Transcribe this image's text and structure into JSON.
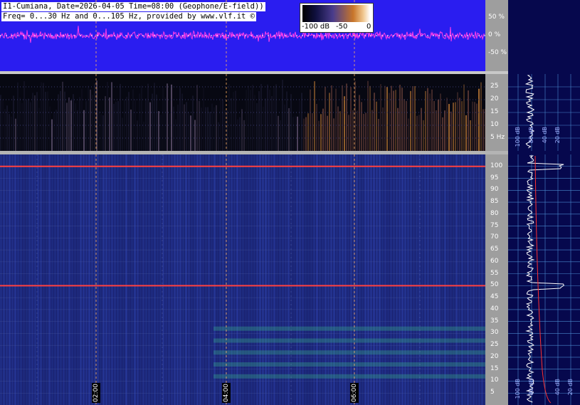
{
  "header": {
    "line1": "I1-Cumiana, Date=2026-04-05 Time=08:00 (Geophone/E-field))",
    "line2": "Freq= 0...30 Hz and 0...105 Hz, provided by www.vlf.it ©"
  },
  "scale": {
    "min_label": "-100 dB",
    "mid_label": "-50",
    "max_label": "0"
  },
  "colors": {
    "waveform_bg": "#2a1df0",
    "waveform_trace": "#ff3ce8",
    "spectrogram_low_bg": "#070812",
    "spectrogram_high_bg": "#1a2270",
    "profile_bg": "#06084d",
    "mains_line": "#ff4040",
    "grid": "#ffb060",
    "profile_curve": "#ffffff",
    "profile_mean": "#ff3030"
  },
  "chart_data": [
    {
      "type": "line",
      "panel": "waveform",
      "ylabel": "",
      "ylim": [
        -100,
        100
      ],
      "yticks": [
        50,
        0,
        -50
      ],
      "ytick_labels": [
        "50 %",
        "0 %",
        "-50 %"
      ]
    },
    {
      "type": "heatmap",
      "panel": "spectrogram-low",
      "yticks": [
        25,
        20,
        15,
        10,
        5
      ],
      "ytick_labels": [
        "25",
        "20",
        "15",
        "10",
        "5 Hz"
      ],
      "ylim": [
        0,
        30
      ]
    },
    {
      "type": "heatmap",
      "panel": "spectrogram-high",
      "yticks": [
        100,
        95,
        90,
        85,
        80,
        75,
        70,
        65,
        60,
        55,
        50,
        45,
        40,
        35,
        30,
        25,
        20,
        15,
        10,
        5
      ],
      "ytick_labels": [
        "100",
        "95",
        "90",
        "85",
        "80",
        "75",
        "70",
        "65",
        "60",
        "55",
        "50",
        "45",
        "40",
        "35",
        "30",
        "25",
        "20",
        "15",
        "10",
        "5"
      ],
      "ylim": [
        0,
        105
      ],
      "xticks": [
        "02:00",
        "04:00",
        "06:00"
      ],
      "mains_lines_hz": [
        50,
        100
      ]
    },
    {
      "type": "line",
      "panel": "profile-low",
      "xtick_labels": [
        "100 dB",
        "80 dB",
        "40 dB",
        "20 dB"
      ]
    },
    {
      "type": "line",
      "panel": "profile-high",
      "xtick_labels": [
        "100 dB",
        "80 dB",
        "40 dB",
        "20 dB"
      ]
    }
  ]
}
